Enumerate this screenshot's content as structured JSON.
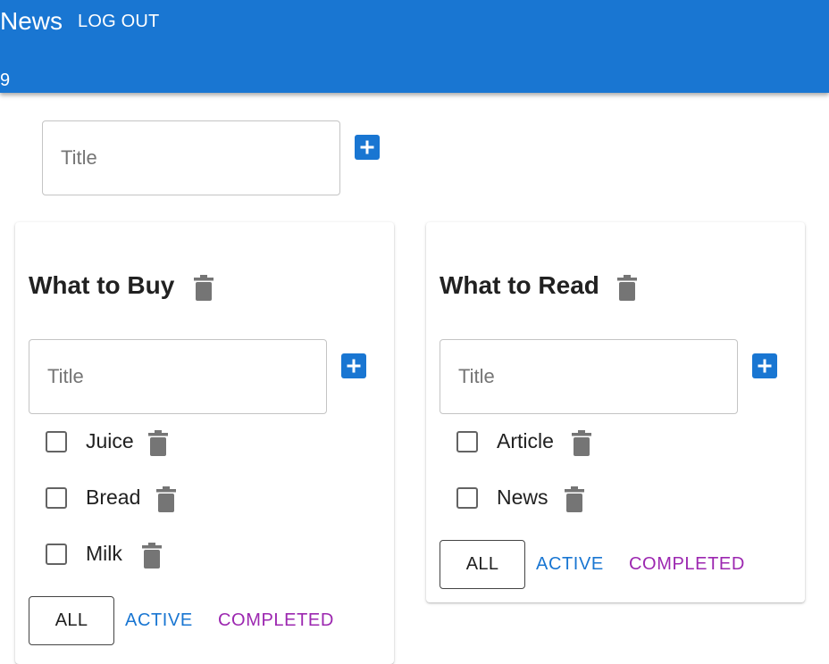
{
  "appbar": {
    "title": "News",
    "logout_label": "LOG OUT",
    "count_text": "9",
    "bg_color": "#1976d2"
  },
  "new_list": {
    "placeholder": "Title",
    "add_icon": "add-box-icon"
  },
  "lists": [
    {
      "title": "What to Buy",
      "input_placeholder": "Title",
      "tasks": [
        {
          "label": "Juice",
          "checked": false
        },
        {
          "label": "Bread",
          "checked": false
        },
        {
          "label": "Milk",
          "checked": false
        }
      ],
      "filters": {
        "all": "ALL",
        "active": "ACTIVE",
        "completed": "COMPLETED"
      }
    },
    {
      "title": "What to Read",
      "input_placeholder": "Title",
      "tasks": [
        {
          "label": "Article",
          "checked": false
        },
        {
          "label": "News",
          "checked": false
        }
      ],
      "filters": {
        "all": "ALL",
        "active": "ACTIVE",
        "completed": "COMPLETED"
      }
    }
  ],
  "colors": {
    "primary": "#1976d2",
    "secondary": "#9c27b0",
    "icon_grey": "#757575"
  }
}
